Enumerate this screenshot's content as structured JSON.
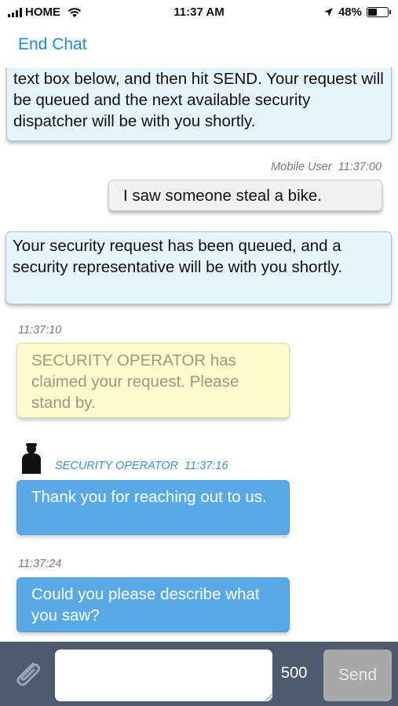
{
  "status_bar": {
    "carrier": "HOME",
    "time": "11:37 AM",
    "battery": "48%",
    "battery_level": 0.48
  },
  "nav": {
    "end_chat_label": "End Chat"
  },
  "messages": [
    {
      "type": "system",
      "text": "text box below, and then hit SEND. Your request will be queued and the next available security dispatcher will be with you shortly."
    },
    {
      "type": "user",
      "meta": "Mobile User  11:37:00",
      "text": "I saw someone steal a bike."
    },
    {
      "type": "system",
      "text": "Your security request has been queued, and a security representative will be with you shortly."
    },
    {
      "type": "claim",
      "meta": "11:37:10",
      "text": "SECURITY OPERATOR has claimed your request. Please stand by."
    },
    {
      "type": "operator",
      "meta": "SECURITY OPERATOR  11:37:16",
      "text": "Thank you for reaching out to us."
    },
    {
      "type": "operator",
      "meta": "11:37:24",
      "text": "Could you please describe what you saw?"
    }
  ],
  "input": {
    "value": "",
    "char_remaining": "500",
    "send_label": "Send"
  },
  "icons": {
    "attach": "paperclip-icon",
    "avatar": "operator-avatar-icon",
    "signal": "signal-icon",
    "wifi": "wifi-icon",
    "location": "location-arrow-icon",
    "battery": "battery-icon"
  },
  "colors": {
    "accent": "#1e88e5",
    "operator_bubble": "#58a9e6",
    "system_bubble": "#e6f4fc",
    "claim_bubble": "#fdfccf",
    "input_bar": "#4e5a6e"
  }
}
